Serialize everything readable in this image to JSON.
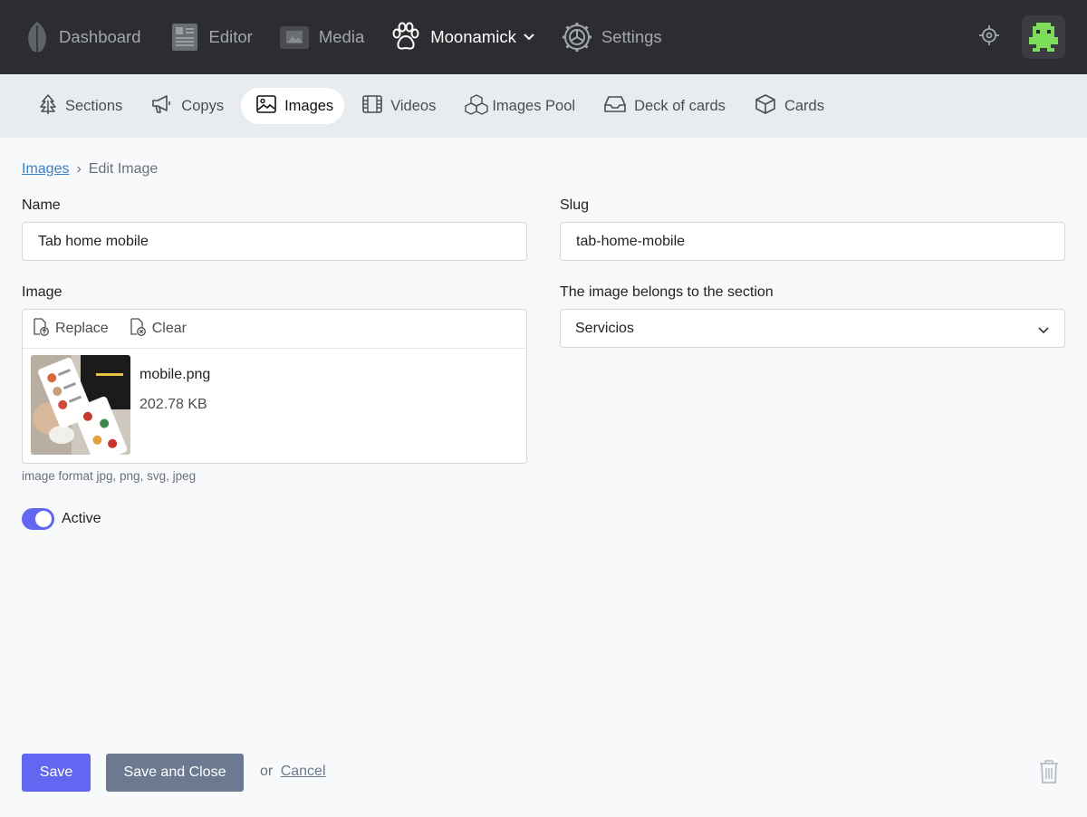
{
  "topnav": {
    "items": [
      {
        "label": "Dashboard",
        "icon": "leaf-icon"
      },
      {
        "label": "Editor",
        "icon": "newspaper-icon"
      },
      {
        "label": "Media",
        "icon": "image-icon"
      },
      {
        "label": "Moonamick",
        "icon": "paw-icon"
      },
      {
        "label": "Settings",
        "icon": "gear-icon"
      }
    ],
    "right_icon": "crosshair-icon",
    "avatar": "pixel-avatar"
  },
  "subnav": {
    "tabs": [
      {
        "label": "Sections",
        "icon": "tree-icon"
      },
      {
        "label": "Copys",
        "icon": "megaphone-icon"
      },
      {
        "label": "Images",
        "icon": "picture-icon"
      },
      {
        "label": "Videos",
        "icon": "film-icon"
      },
      {
        "label": "Images Pool",
        "icon": "cubes-icon"
      },
      {
        "label": "Deck of cards",
        "icon": "inbox-icon"
      },
      {
        "label": "Cards",
        "icon": "cube-icon"
      }
    ],
    "active": "Images"
  },
  "breadcrumb": {
    "parent": "Images",
    "separator": "›",
    "current": "Edit Image"
  },
  "form": {
    "name_label": "Name",
    "name_value": "Tab home mobile",
    "slug_label": "Slug",
    "slug_value": "tab-home-mobile",
    "image_label": "Image",
    "replace_label": "Replace",
    "clear_label": "Clear",
    "file_name": "mobile.png",
    "file_size": "202.78 KB",
    "image_hint": "image format jpg, png, svg, jpeg",
    "section_label": "The image belongs to the section",
    "section_value": "Servicios",
    "active_label": "Active",
    "active": true
  },
  "actions": {
    "save": "Save",
    "save_close": "Save and Close",
    "or": "or",
    "cancel": "Cancel"
  },
  "colors": {
    "accent": "#6366f1",
    "topbar": "#2b2d31",
    "subnav": "#e8ebf0",
    "secondary_button": "#6b7a90"
  }
}
